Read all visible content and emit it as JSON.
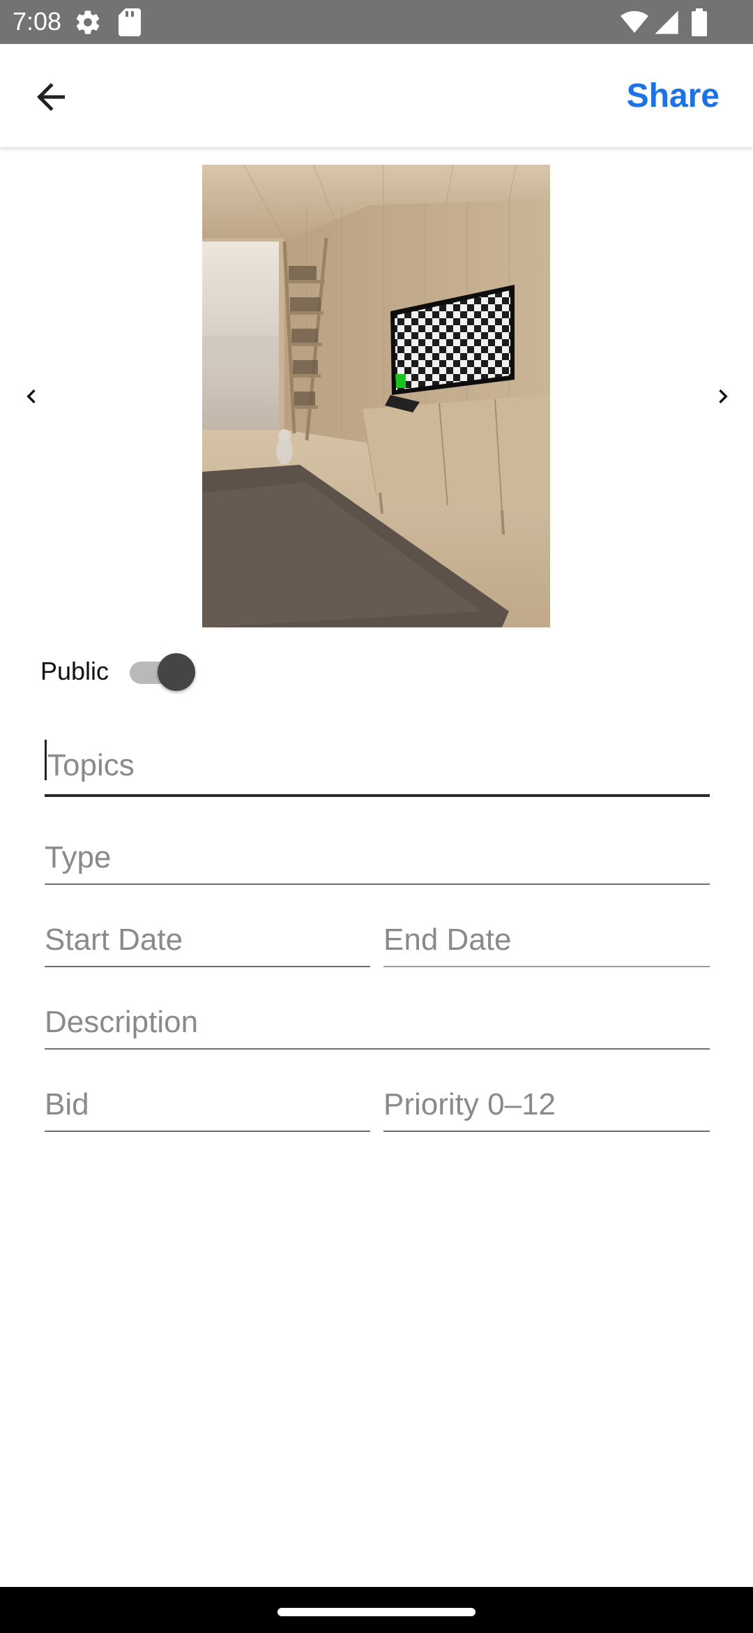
{
  "status_bar": {
    "time": "7:08",
    "icons": [
      "gear-icon",
      "sd-card-icon",
      "wifi-icon",
      "signal-icon",
      "battery-icon"
    ]
  },
  "app_bar": {
    "back_icon": "arrow-left-icon",
    "share_label": "Share",
    "accent_color": "#1a73e8"
  },
  "carousel": {
    "image_description": "living room with tv",
    "prev_icon": "chevron-left-icon",
    "next_icon": "chevron-right-icon"
  },
  "public_toggle": {
    "label": "Public",
    "on": true
  },
  "form": {
    "topics": {
      "placeholder": "Topics",
      "value": ""
    },
    "type": {
      "placeholder": "Type",
      "value": ""
    },
    "start_date": {
      "placeholder": "Start Date",
      "value": ""
    },
    "end_date": {
      "placeholder": "End Date",
      "value": ""
    },
    "description": {
      "placeholder": "Description",
      "value": ""
    },
    "bid": {
      "placeholder": "Bid",
      "value": ""
    },
    "priority": {
      "placeholder": "Priority 0–12",
      "value": ""
    }
  }
}
